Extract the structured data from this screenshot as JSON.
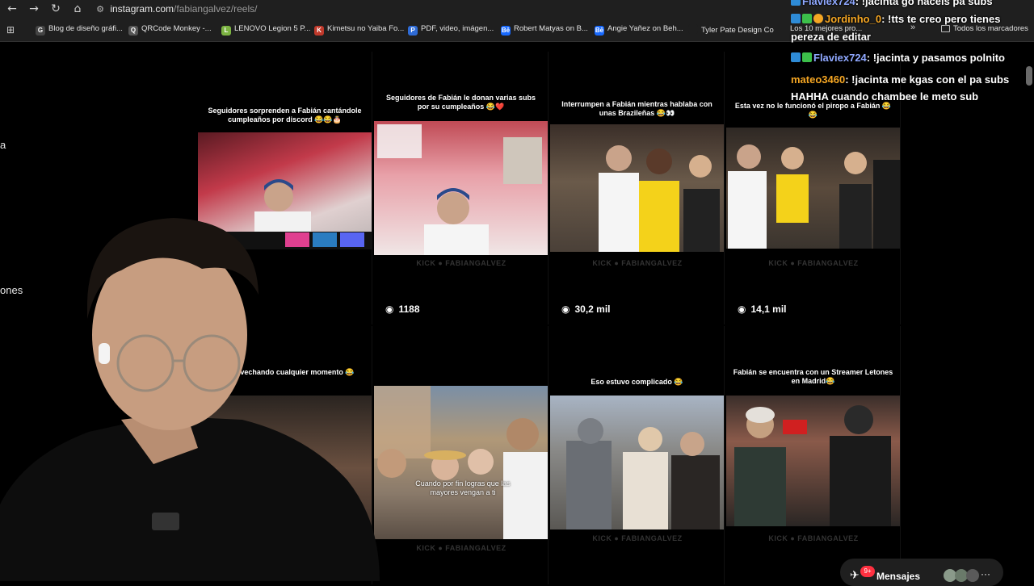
{
  "browser": {
    "url_host": "instagram.com",
    "url_path": "/fabiangalvez/reels/",
    "bookmarks": [
      {
        "label": "Blog de diseño gráfi...",
        "icon_color": "#444"
      },
      {
        "label": "QRCode Monkey -...",
        "icon_color": "#555"
      },
      {
        "label": "LENOVO Legion 5 P...",
        "icon_color": "#e2231a"
      },
      {
        "label": "Kimetsu no Yaiba Fo...",
        "icon_color": "#c0392b"
      },
      {
        "label": "PDF, video, imágen...",
        "icon_color": "#2e6bd6"
      },
      {
        "label": "Robert Matyas on B...",
        "icon_color": "#1769ff"
      },
      {
        "label": "Angie Yañez on Beh...",
        "icon_color": "#1769ff"
      },
      {
        "label": "Tyler Pate Design Co",
        "icon_color": "#1f1f1f"
      },
      {
        "label": "Los 10 mejores pro...",
        "icon_color": "#1f1f1f"
      },
      {
        "label": "Todos los marcadores",
        "icon_color": "#1f1f1f"
      }
    ]
  },
  "left_sidebar": {
    "fragment_a": "a",
    "fragment_b": "ones"
  },
  "reels": [
    {
      "caption": "Seguidores sorprenden a Fabián cantándole cumpleaños por discord 😂😂🎂",
      "views": "",
      "thumb_top": "#3a1a22"
    },
    {
      "caption": "Seguidores de Fabián le donan varias subs por su cumpleaños 😂❤️",
      "views": "1188",
      "thumb_top": "#5a2830"
    },
    {
      "caption": "Interrumpen a Fabián mientras hablaba con unas Brazileñas 😂👀",
      "views": "30,2 mil",
      "thumb_top": "#2f2a26"
    },
    {
      "caption": "Esta vez no le funcionó el piropo a Fabián 😂😂",
      "views": "14,1 mil",
      "thumb_top": "#2a2624"
    },
    {
      "caption": "ro aprovechando cualquier momento 😂",
      "views": "",
      "thumb_top": "#2b2522"
    },
    {
      "caption": "",
      "overlay": "Cuando por fin logras que las mayores vengan a ti",
      "views": "",
      "thumb_top": "#4a4a48"
    },
    {
      "caption": "Eso estuvo complicado 😂",
      "views": "",
      "thumb_top": "#3a3a3c"
    },
    {
      "caption": "Fabián se encuentra con un Streamer Letones en Madrid😂",
      "views": "",
      "thumb_top": "#2e2a2a"
    }
  ],
  "watermark": "KICK ● FABIANGALVEZ",
  "chat": [
    {
      "user": "Flaviex724",
      "message": ": !jacinta go haceis pa subs",
      "user_color": "#8fa8ff"
    },
    {
      "user": "Jordinho_0",
      "message": ": !tts te creo pero tienes",
      "user_color": "#f5a623"
    },
    {
      "user": "",
      "message": "pereza de editar",
      "user_color": "#fff"
    },
    {
      "user": "Flaviex724",
      "message": ": !jacinta y pasamos polnito",
      "user_color": "#8fa8ff"
    },
    {
      "user": "mateo3460",
      "message": ": !jacinta me kgas con el pa subs",
      "user_color": "#f5a623"
    },
    {
      "user": "",
      "message": "HAHHA cuando chambee le meto sub",
      "user_color": "#fff"
    }
  ],
  "messages_bar": {
    "label": "Mensajes",
    "count": "9+"
  },
  "icons": {
    "back": "back-arrow-icon",
    "forward": "forward-arrow-icon",
    "reload": "reload-icon",
    "home": "home-icon",
    "apps": "apps-grid-icon",
    "eye": "eye-icon"
  }
}
